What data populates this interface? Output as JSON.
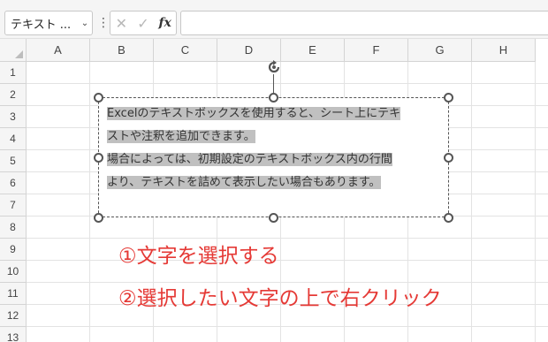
{
  "formula_bar": {
    "name_box": "テキスト ...",
    "more": "⋮",
    "cancel": "✕",
    "enter": "✓",
    "fx": "fx",
    "formula": ""
  },
  "columns": [
    "A",
    "B",
    "C",
    "D",
    "E",
    "F",
    "G",
    "H"
  ],
  "rows": [
    "1",
    "2",
    "3",
    "4",
    "5",
    "6",
    "7",
    "8",
    "9",
    "10",
    "11",
    "12",
    "13"
  ],
  "textbox": {
    "lines": [
      "Excelのテキストボックスを使用すると、シート上にテキ",
      "ストや注釈を追加できます。",
      "場合によっては、初期設定のテキストボックス内の行間",
      "より、テキストを詰めて表示したい場合もあります。"
    ]
  },
  "annotations": {
    "step1": "①文字を選択する",
    "step2": "②選択したい文字の上で右クリック"
  },
  "colors": {
    "annotation": "#e53935",
    "selection": "#c0c0c0",
    "gridline": "#e3e3e3",
    "header_bg": "#f5f5f5"
  }
}
